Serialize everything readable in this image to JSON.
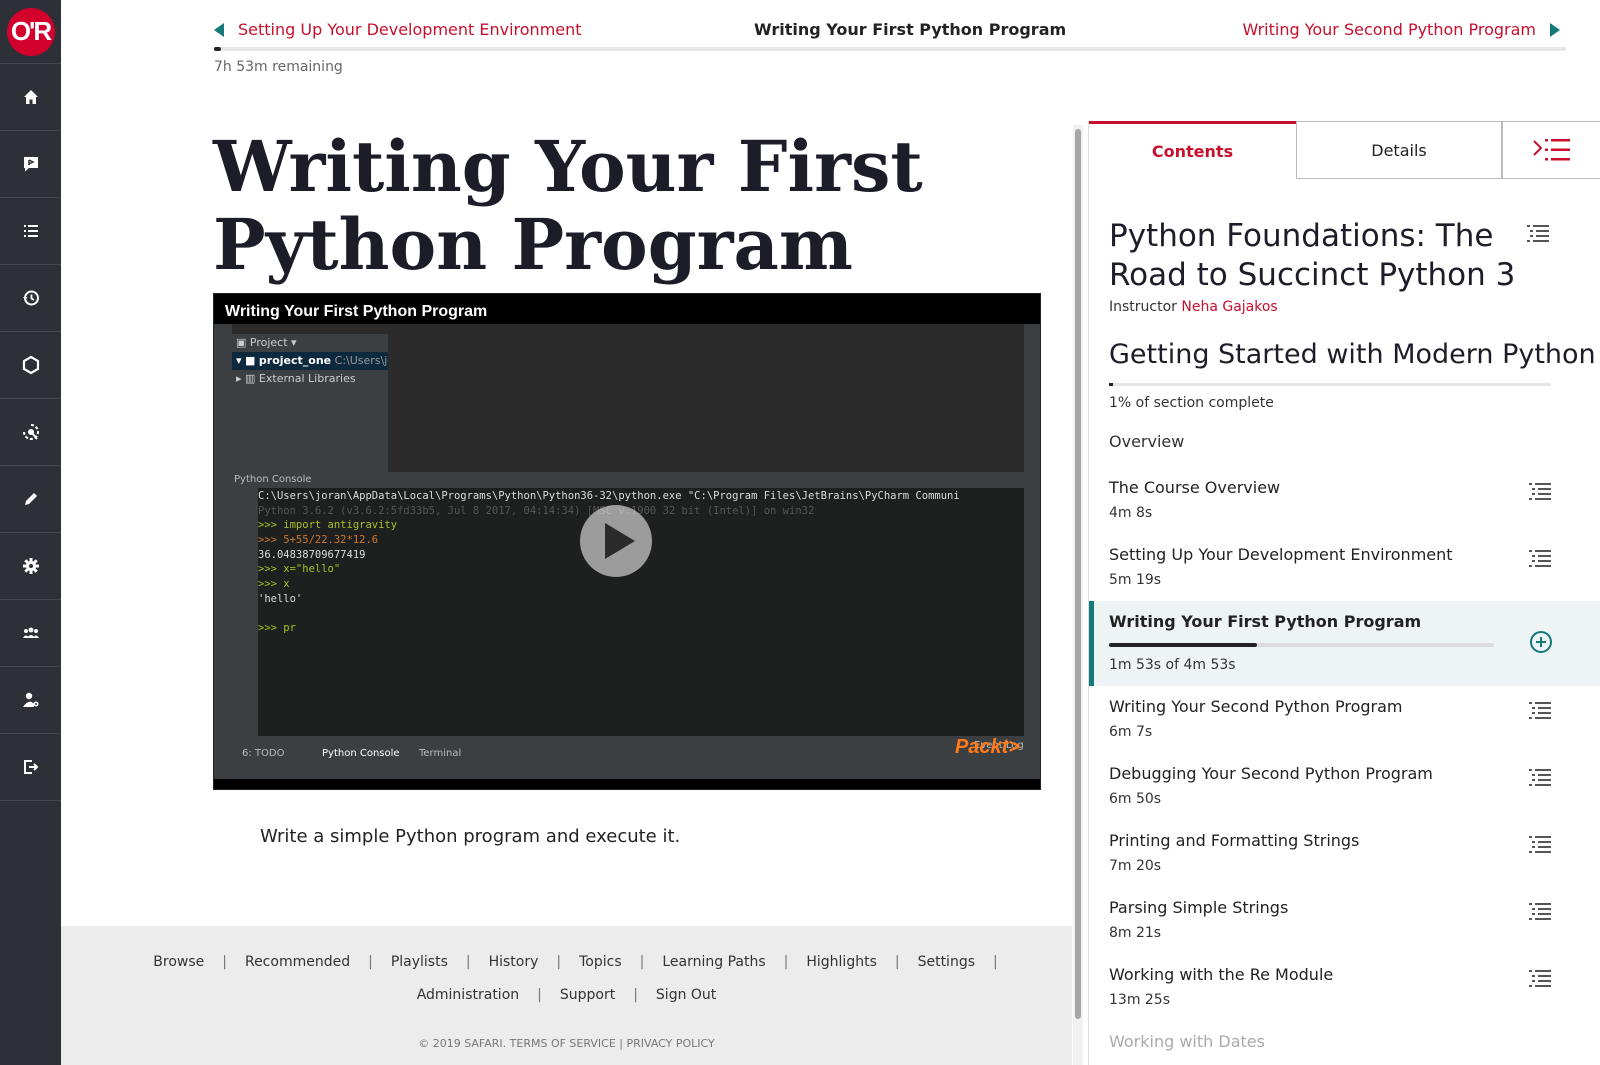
{
  "sidebar": {
    "logo_text": "O'R",
    "items": [
      {
        "icon": "home-icon"
      },
      {
        "icon": "chat-icon"
      },
      {
        "icon": "list-icon"
      },
      {
        "icon": "history-icon"
      },
      {
        "icon": "hexagon-icon"
      },
      {
        "icon": "target-icon"
      },
      {
        "icon": "pencil-icon"
      },
      {
        "icon": "gear-icon"
      },
      {
        "icon": "team-icon"
      },
      {
        "icon": "user-admin-icon"
      },
      {
        "icon": "sign-out-icon"
      }
    ]
  },
  "topbar": {
    "prev_label": "Setting Up Your Development Environment",
    "current_label": "Writing Your First Python Program",
    "next_label": "Writing Your Second Python Program",
    "remaining": "7h 53m remaining",
    "course_progress_fraction": 0.005
  },
  "main": {
    "title": "Writing Your First Python Program",
    "video_title": "Writing Your First Python Program",
    "description": "Write a simple Python program and execute it."
  },
  "ide": {
    "project_header": "Project",
    "project_root": "project_one",
    "project_path": "C:\\Users\\jc",
    "external_libs": "External Libraries",
    "console_label": "Python Console",
    "console_lines": [
      "C:\\Users\\joran\\AppData\\Local\\Programs\\Python\\Python36-32\\python.exe \"C:\\Program Files\\JetBrains\\PyCharm Communi",
      "Python 3.6.2 (v3.6.2:5fd33b5, Jul  8 2017, 04:14:34) [MSC v.1900 32 bit (Intel)] on win32",
      ">>> import antigravity",
      ">>> 5+55/22.32*12.6",
      "36.04838709677419",
      ">>> x=\"hello\"",
      ">>> x",
      "'hello'",
      "",
      ">>> pr"
    ],
    "bottom_tabs": [
      "6: TODO",
      "Python Console",
      "Terminal"
    ],
    "event_log": "Event Log",
    "brand": "Packt>"
  },
  "footer": {
    "row1": [
      "Browse",
      "Recommended",
      "Playlists",
      "History",
      "Topics",
      "Learning Paths",
      "Highlights",
      "Settings"
    ],
    "row2": [
      "Administration",
      "Support",
      "Sign Out"
    ],
    "copyright": "© 2019 SAFARI. TERMS OF SERVICE | PRIVACY POLICY"
  },
  "panel": {
    "tab_contents": "Contents",
    "tab_details": "Details",
    "course_title": "Python Foundations: The Road to Succinct Python 3",
    "instructor_label": "Instructor",
    "instructor_name": "Neha Gajakos",
    "section_title": "Getting Started with Modern Python",
    "section_progress_fraction": 0.01,
    "section_complete": "1% of section complete",
    "overview": "Overview",
    "lessons": [
      {
        "title": "The Course Overview",
        "duration": "4m 8s"
      },
      {
        "title": "Setting Up Your Development Environment",
        "duration": "5m 19s"
      },
      {
        "title": "Writing Your First Python Program",
        "duration": "1m 53s of 4m 53s",
        "active": true,
        "progress_fraction": 0.385
      },
      {
        "title": "Writing Your Second Python Program",
        "duration": "6m 7s"
      },
      {
        "title": "Debugging Your Second Python Program",
        "duration": "6m 50s"
      },
      {
        "title": "Printing and Formatting Strings",
        "duration": "7m 20s"
      },
      {
        "title": "Parsing Simple Strings",
        "duration": "8m 21s"
      },
      {
        "title": "Working with the Re Module",
        "duration": "13m 25s"
      },
      {
        "title": "Working with Dates",
        "duration": ""
      }
    ]
  },
  "colors": {
    "brand_red": "#c8102e",
    "accent_teal": "#15787a",
    "sidebar_bg": "#2e3037"
  }
}
